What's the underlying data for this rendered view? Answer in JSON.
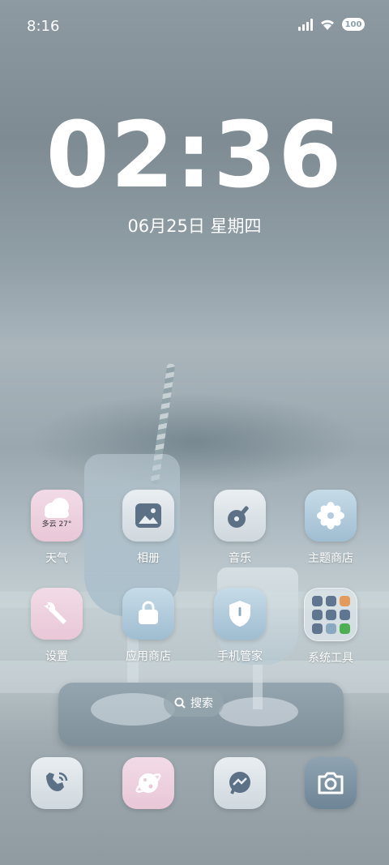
{
  "status_bar": {
    "time": "8:16",
    "battery": "100"
  },
  "lock_clock": {
    "time": "02:36",
    "date": "06月25日  星期四"
  },
  "apps": [
    {
      "label": "天气",
      "badge": "多云 27°"
    },
    {
      "label": "相册"
    },
    {
      "label": "音乐"
    },
    {
      "label": "主题商店"
    },
    {
      "label": "设置"
    },
    {
      "label": "应用商店"
    },
    {
      "label": "手机管家"
    },
    {
      "label": "系统工具"
    }
  ],
  "search": {
    "label": "搜索"
  },
  "dock": [
    "phone-icon",
    "browser-icon",
    "messenger-icon",
    "camera-icon"
  ],
  "colors": {
    "pink_tile": "#efd7e3",
    "gray_tile": "#e3e9ed",
    "blue_tile": "#b3cde0"
  }
}
